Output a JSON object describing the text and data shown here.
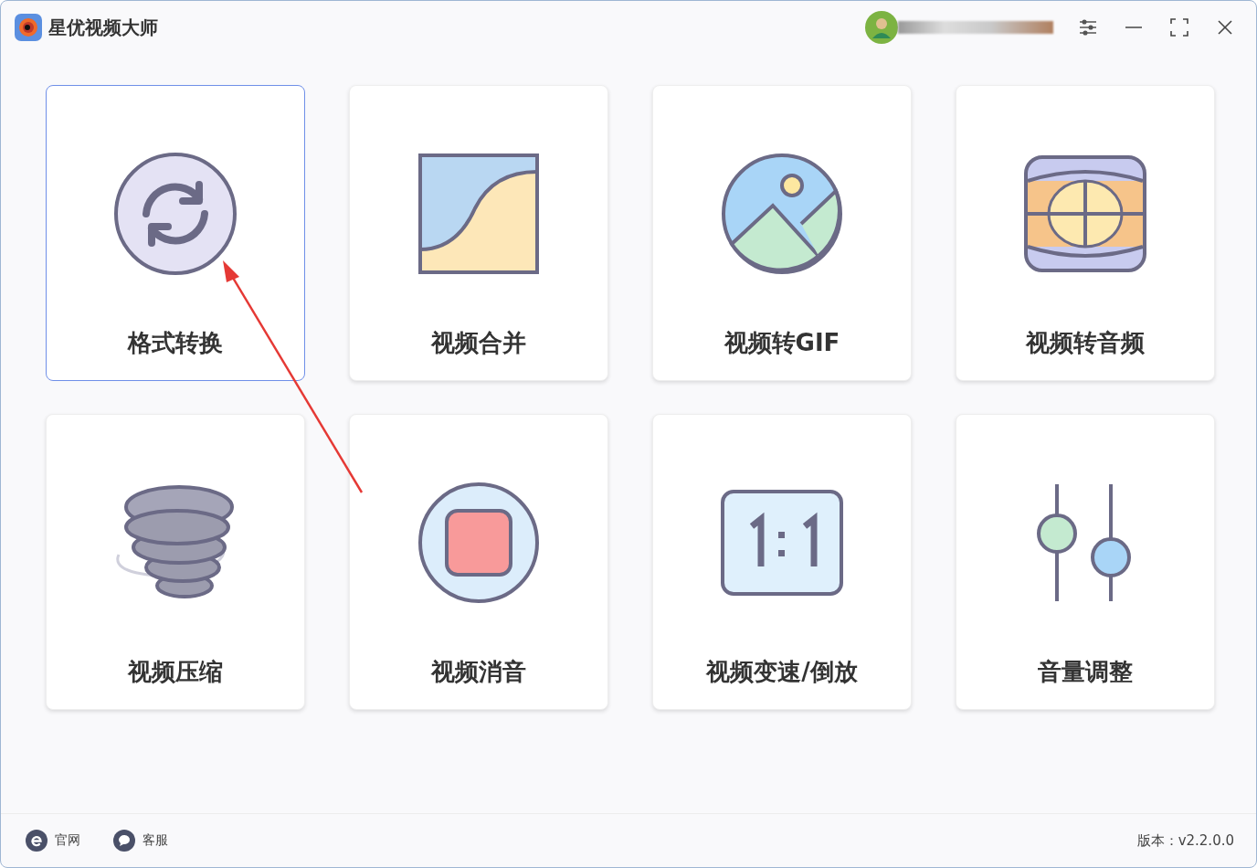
{
  "window": {
    "title": "星优视频大师"
  },
  "tools": [
    {
      "label": "格式转换",
      "selected": true
    },
    {
      "label": "视频合并",
      "selected": false
    },
    {
      "label": "视频转GIF",
      "selected": false
    },
    {
      "label": "视频转音频",
      "selected": false
    },
    {
      "label": "视频压缩",
      "selected": false
    },
    {
      "label": "视频消音",
      "selected": false
    },
    {
      "label": "视频变速/倒放",
      "selected": false
    },
    {
      "label": "音量调整",
      "selected": false
    }
  ],
  "footer": {
    "links": [
      {
        "label": "官网",
        "kind": "web"
      },
      {
        "label": "客服",
        "kind": "chat"
      }
    ],
    "version": "版本：v2.2.0.0"
  }
}
